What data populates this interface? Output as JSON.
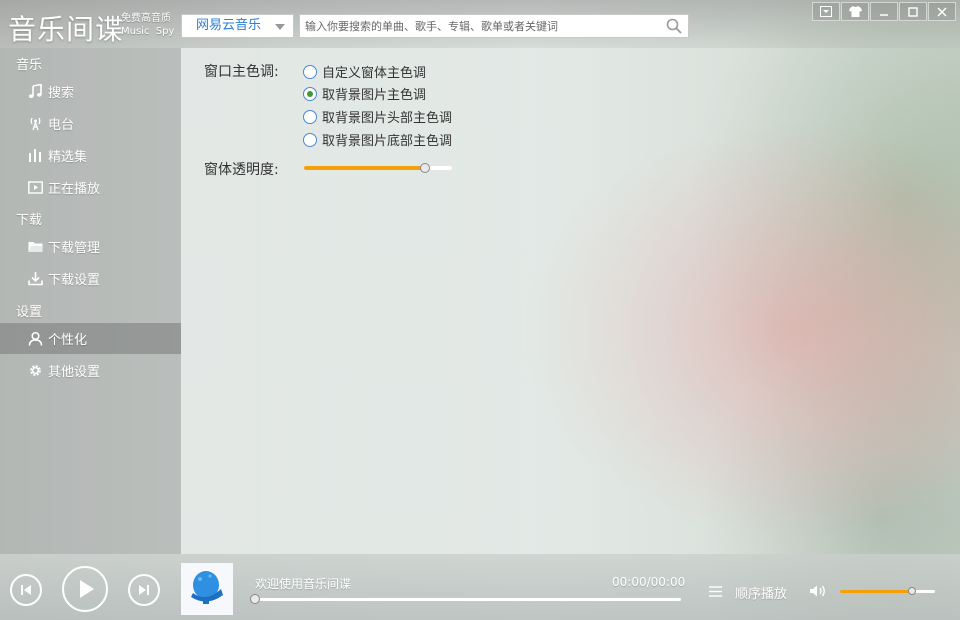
{
  "app": {
    "logo": "音乐间谍",
    "logo_sub_line1": "免费高音质",
    "logo_sub_line2": "Music  Spy"
  },
  "header": {
    "source_selected": "网易云音乐",
    "search_placeholder": "输入你要搜索的单曲、歌手、专辑、歌单或者关键词"
  },
  "sidebar": {
    "sections": [
      {
        "title": "音乐",
        "items": [
          {
            "label": "搜索",
            "icon": "music-note-icon"
          },
          {
            "label": "电台",
            "icon": "radio-antenna-icon"
          },
          {
            "label": "精选集",
            "icon": "bars-icon"
          },
          {
            "label": "正在播放",
            "icon": "play-screen-icon"
          }
        ]
      },
      {
        "title": "下载",
        "items": [
          {
            "label": "下载管理",
            "icon": "folder-icon"
          },
          {
            "label": "下载设置",
            "icon": "download-icon"
          }
        ]
      },
      {
        "title": "设置",
        "items": [
          {
            "label": "个性化",
            "icon": "user-icon",
            "active": true
          },
          {
            "label": "其他设置",
            "icon": "gear-icon"
          }
        ]
      }
    ]
  },
  "settings": {
    "theme_color_label": "窗口主色调:",
    "theme_options": [
      {
        "label": "自定义窗体主色调",
        "checked": false
      },
      {
        "label": "取背景图片主色调",
        "checked": true
      },
      {
        "label": "取背景图片头部主色调",
        "checked": false
      },
      {
        "label": "取背景图片底部主色调",
        "checked": false
      }
    ],
    "opacity_label": "窗体透明度:",
    "opacity_value": 0.82
  },
  "player": {
    "track_title": "欢迎使用音乐间谍",
    "time": "00:00/00:00",
    "progress": 0,
    "play_mode": "顺序播放",
    "volume": 0.76
  },
  "colors": {
    "accent_blue": "#2b7fd6",
    "slider_orange": "#f5a00a",
    "radio_checked": "#3f9a2f"
  }
}
